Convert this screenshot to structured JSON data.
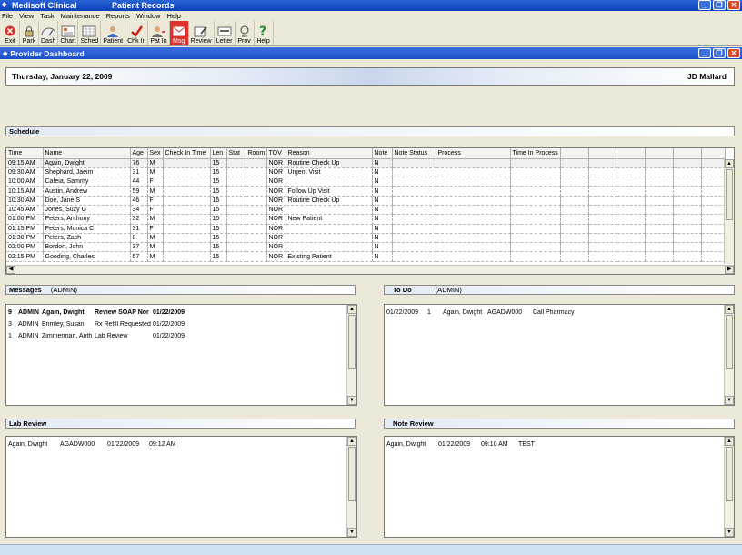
{
  "window": {
    "app_title": "Medisoft Clinical",
    "doc_title": "Patient Records",
    "child_title": "Provider Dashboard"
  },
  "menu": [
    "File",
    "View",
    "Task",
    "Maintenance",
    "Reports",
    "Window",
    "Help"
  ],
  "toolbar": [
    {
      "label": "Exit",
      "icon": "exit-icon"
    },
    {
      "label": "Park",
      "icon": "lock-icon"
    },
    {
      "label": "Dash",
      "icon": "dashboard-icon"
    },
    {
      "label": "Chart",
      "icon": "chart-icon"
    },
    {
      "label": "Sched",
      "icon": "calendar-icon"
    },
    {
      "label": "Patient",
      "icon": "patient-icon"
    },
    {
      "label": "Chk In",
      "icon": "check-icon"
    },
    {
      "label": "Pat In",
      "icon": "patient-in-icon"
    },
    {
      "label": "Msg",
      "icon": "message-icon"
    },
    {
      "label": "Review",
      "icon": "review-icon"
    },
    {
      "label": "Letter",
      "icon": "letter-icon"
    },
    {
      "label": "Prov",
      "icon": "provider-icon"
    },
    {
      "label": "Help",
      "icon": "help-icon"
    }
  ],
  "dashboard": {
    "date": "Thursday, January 22, 2009",
    "user": "JD Mallard"
  },
  "schedule": {
    "title": "Schedule",
    "columns": [
      "Time",
      "Name",
      "Age",
      "Sex",
      "Check In Time",
      "Len",
      "Stat",
      "Room",
      "TOV",
      "Reason",
      "Note",
      "Note Status",
      "Process",
      "Time In Process",
      "",
      "",
      "",
      "",
      "",
      ""
    ],
    "rows": [
      [
        "09:15 AM",
        "Again, Dwight",
        "76",
        "M",
        "",
        "15",
        "",
        "",
        "NOR",
        "Routine Check Up",
        "N"
      ],
      [
        "09:30 AM",
        "Shephard, Jaeim",
        "31",
        "M",
        "",
        "15",
        "",
        "",
        "NOR",
        "Urgent Visit",
        "N"
      ],
      [
        "10:00 AM",
        "Cafeia, Sammy",
        "44",
        "F",
        "",
        "15",
        "",
        "",
        "NOR",
        "",
        "N"
      ],
      [
        "10:15 AM",
        "Austin, Andrew",
        "59",
        "M",
        "",
        "15",
        "",
        "",
        "NOR",
        "Follow Up Visit",
        "N"
      ],
      [
        "10:30 AM",
        "Doe, Jane S",
        "46",
        "F",
        "",
        "15",
        "",
        "",
        "NOR",
        "Routine Check Up",
        "N"
      ],
      [
        "10:45 AM",
        "Jones, Suzy G",
        "34",
        "F",
        "",
        "15",
        "",
        "",
        "NOR",
        "",
        "N"
      ],
      [
        "01:00 PM",
        "Peters, Anthony",
        "32",
        "M",
        "",
        "15",
        "",
        "",
        "NOR",
        "New Patient",
        "N"
      ],
      [
        "01:15 PM",
        "Peters, Monica C",
        "31",
        "F",
        "",
        "15",
        "",
        "",
        "NOR",
        "",
        "N"
      ],
      [
        "01:30 PM",
        "Peters, Zach",
        "8",
        "M",
        "",
        "15",
        "",
        "",
        "NOR",
        "",
        "N"
      ],
      [
        "02:00 PM",
        "Bordon, John",
        "37",
        "M",
        "",
        "15",
        "",
        "",
        "NOR",
        "",
        "N"
      ],
      [
        "02:15 PM",
        "Gooding, Charles",
        "57",
        "M",
        "",
        "15",
        "",
        "",
        "NOR",
        "Existing Patient",
        "N"
      ]
    ]
  },
  "messages": {
    "title": "Messages",
    "owner": "(ADMIN)",
    "rows": [
      {
        "count": "9",
        "user": "ADMIN",
        "patient": "Again, Dwight",
        "subject": "Review SOAP Nor",
        "date": "01/22/2009",
        "bold": true
      },
      {
        "count": "3",
        "user": "ADMIN",
        "patient": "Brimley, Susan",
        "subject": "Rx Refill Requested",
        "date": "01/22/2009",
        "bold": false
      },
      {
        "count": "1",
        "user": "ADMIN",
        "patient": "Zimmerman, Anth",
        "subject": "Lab Review",
        "date": "01/22/2009",
        "bold": false
      }
    ]
  },
  "todo": {
    "title": "To Do",
    "owner": "(ADMIN)",
    "rows": [
      {
        "date": "01/22/2009",
        "num": "1",
        "patient": "Again, Dwight",
        "code": "AGADW000",
        "task": "Call Pharmacy"
      }
    ]
  },
  "lab_review": {
    "title": "Lab Review",
    "rows": [
      {
        "patient": "Again, Dwight",
        "code": "AGADW000",
        "date": "01/22/2009",
        "time": "09:12 AM"
      }
    ]
  },
  "note_review": {
    "title": "Note Review",
    "rows": [
      {
        "patient": "Again, Dwight",
        "date": "01/22/2009",
        "time": "09:10 AM",
        "note": "TEST"
      }
    ]
  },
  "colors": {
    "titlebar": "#0a3fb8",
    "active_tool": "#e0302c"
  }
}
